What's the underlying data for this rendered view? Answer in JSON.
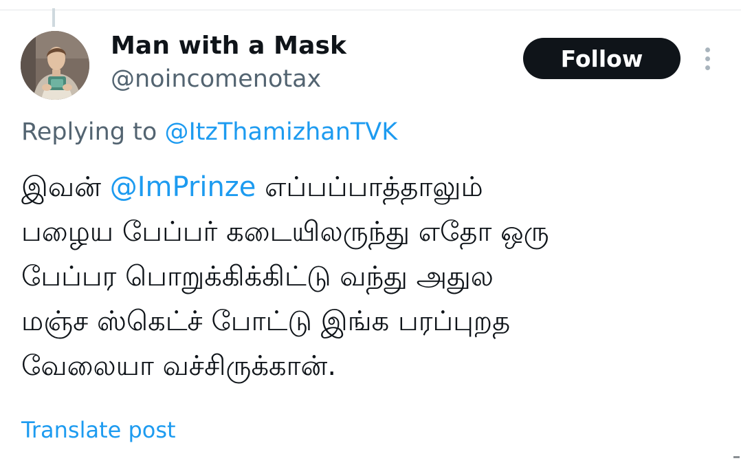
{
  "author": {
    "display_name": "Man with a Mask",
    "handle": "@noincomenotax",
    "avatar_icon": "profile-photo"
  },
  "actions": {
    "follow_label": "Follow",
    "more_icon": "more-vertical-icon"
  },
  "reply": {
    "prefix": "Replying to",
    "mention": "@ItzThamizhanTVK"
  },
  "tweet": {
    "line1_before": "இவன் ",
    "line1_mention": "@ImPrinze",
    "line1_after": " எப்பப்பாத்தாலும்",
    "line2": "பழைய பேப்பர் கடையிலருந்து எதோ ஒரு",
    "line3": "பேப்பர பொறுக்கிக்கிட்டு வந்து அதுல",
    "line4": "மஞ்ச ஸ்கெட்ச் போட்டு இங்க பரப்புறத",
    "line5": "வேலையா வச்சிருக்கான்."
  },
  "translate_label": "Translate post",
  "colors": {
    "text_primary": "#0f1419",
    "text_secondary": "#536471",
    "accent": "#1d9bf0",
    "button_bg": "#0f1419"
  }
}
